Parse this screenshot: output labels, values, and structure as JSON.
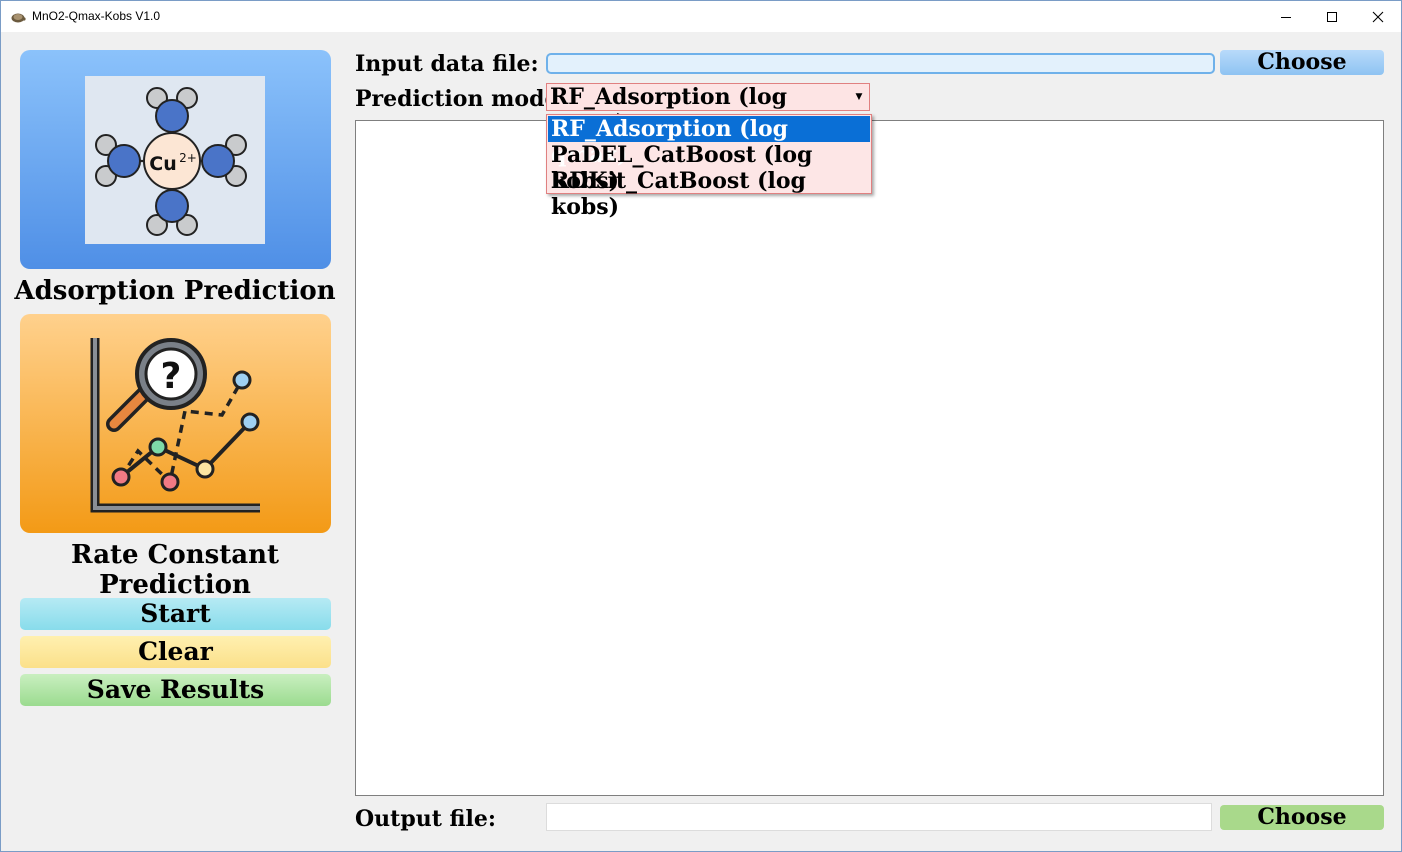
{
  "window": {
    "title": "MnO2-Qmax-Kobs V1.0",
    "icon": "tortoise-app-icon",
    "controls": [
      "minimize-icon",
      "maximize-icon",
      "close-icon"
    ]
  },
  "sidebar": {
    "adsorption": {
      "label": "Adsorption Prediction",
      "icon": "copper-complex-icon",
      "ion_text": "Cu",
      "ion_charge": "2+"
    },
    "rate": {
      "label": "Rate Constant Prediction",
      "icon": "chart-analysis-icon",
      "query_mark": "?"
    },
    "buttons": {
      "start": "Start",
      "clear": "Clear",
      "save": "Save Results"
    }
  },
  "main": {
    "input_label": "Input data file:",
    "input_value": "",
    "choose_input": "Choose",
    "model_label": "Prediction model:",
    "model_selected": "RF_Adsorption (log qmax)",
    "model_options": [
      "RF_Adsorption (log qmax)",
      "PaDEL_CatBoost (log kobs)",
      "RDKit_CatBoost (log kobs)"
    ],
    "output_label": "Output file:",
    "output_value": "",
    "choose_output": "Choose"
  },
  "colors": {
    "adsorption_card": "#4f8fe6",
    "rate_card": "#f39a16",
    "start": "#88dceb",
    "clear": "#fbe08a",
    "save": "#9bdb8f",
    "dropdown_highlight": "#0a6fd6"
  }
}
